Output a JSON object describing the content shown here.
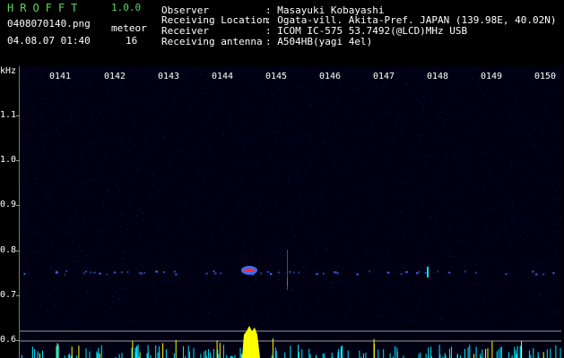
{
  "header": {
    "app_name": "HROFFT",
    "version": "1.0.0",
    "filename": "0408070140.png",
    "datetime": "04.08.07 01:40",
    "meteor_label": "meteor",
    "meteor_count": "16",
    "observer_label": "Observer",
    "observer_value": ": Masayuki Kobayashi",
    "location_label": "Receiving Location",
    "location_value": ": Ogata-vill. Akita-Pref. JAPAN (139.98E, 40.02N)",
    "receiver_label": "Receiver",
    "receiver_value": ": ICOM IC-575 53.7492(@LCD)MHz USB",
    "antenna_label": "Receiving antenna",
    "antenna_value": ": A504HB(yagi 4el)"
  },
  "spectrogram": {
    "y_unit": "kHz",
    "time_ticks": [
      "0141",
      "0142",
      "0143",
      "0144",
      "0145",
      "0146",
      "0147",
      "0148",
      "0149",
      "0150"
    ],
    "freq_ticks": [
      "1.1",
      "1.0",
      "0.9",
      "0.8",
      "0.7",
      "0.6"
    ],
    "colors": {
      "background": "#000012",
      "noise": "#1a1a6e",
      "band": "#3c6cff",
      "hot": "#ff3030",
      "level": "#ffff00",
      "level2": "#00e5ff",
      "text_green": "#5fd35f"
    }
  }
}
